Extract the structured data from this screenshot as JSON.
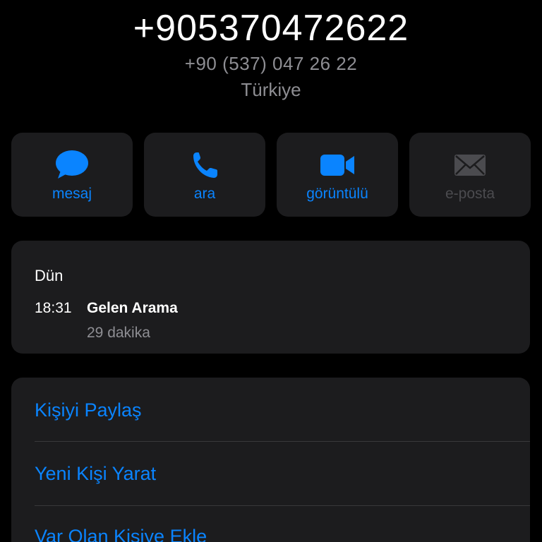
{
  "header": {
    "phone_number": "+905370472622",
    "phone_formatted": "+90 (537) 047 26 22",
    "country": "Türkiye"
  },
  "action_buttons": [
    {
      "label": "mesaj",
      "icon": "message-bubble-icon",
      "enabled": true
    },
    {
      "label": "ara",
      "icon": "phone-icon",
      "enabled": true
    },
    {
      "label": "görüntülü",
      "icon": "video-camera-icon",
      "enabled": true
    },
    {
      "label": "e-posta",
      "icon": "envelope-icon",
      "enabled": false
    }
  ],
  "recents": {
    "day": "Dün",
    "entries": [
      {
        "time": "18:31",
        "type": "Gelen Arama",
        "duration": "29 dakika"
      }
    ]
  },
  "contact_actions": [
    {
      "label": "Kişiyi Paylaş"
    },
    {
      "label": "Yeni Kişi Yarat"
    },
    {
      "label": "Var Olan Kişiye Ekle"
    }
  ],
  "colors": {
    "background": "#000000",
    "card": "#1c1c1e",
    "accent": "#0a84ff",
    "secondary_text": "#8e8e93",
    "disabled": "#4b4b4f",
    "divider": "#38383a"
  }
}
